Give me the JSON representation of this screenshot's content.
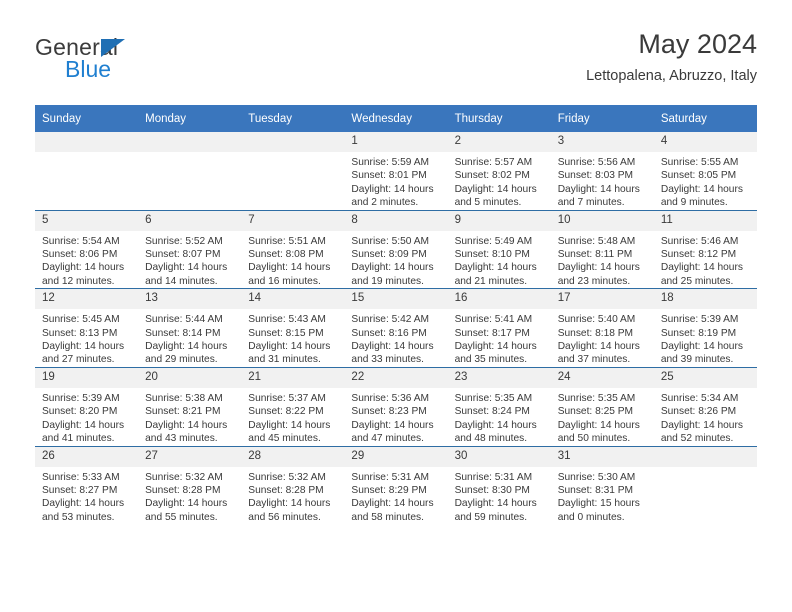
{
  "brand": {
    "name_top": "General",
    "name_bottom": "Blue",
    "triangle_color": "#1f6fb4",
    "blue_color": "#1f7fd0"
  },
  "header": {
    "title": "May 2024",
    "subtitle": "Lettopalena, Abruzzo, Italy"
  },
  "theme": {
    "header_band": "#3a76bd",
    "row_separator": "#2e6da4",
    "daynum_band": "#f1f1f1",
    "text": "#3a3a3a"
  },
  "weekdays": [
    "Sunday",
    "Monday",
    "Tuesday",
    "Wednesday",
    "Thursday",
    "Friday",
    "Saturday"
  ],
  "weeks": [
    [
      {
        "day": "",
        "sunrise": "",
        "sunset": "",
        "daylight": "",
        "empty": true
      },
      {
        "day": "",
        "sunrise": "",
        "sunset": "",
        "daylight": "",
        "empty": true
      },
      {
        "day": "",
        "sunrise": "",
        "sunset": "",
        "daylight": "",
        "empty": true
      },
      {
        "day": "1",
        "sunrise": "Sunrise: 5:59 AM",
        "sunset": "Sunset: 8:01 PM",
        "daylight": "Daylight: 14 hours and 2 minutes."
      },
      {
        "day": "2",
        "sunrise": "Sunrise: 5:57 AM",
        "sunset": "Sunset: 8:02 PM",
        "daylight": "Daylight: 14 hours and 5 minutes."
      },
      {
        "day": "3",
        "sunrise": "Sunrise: 5:56 AM",
        "sunset": "Sunset: 8:03 PM",
        "daylight": "Daylight: 14 hours and 7 minutes."
      },
      {
        "day": "4",
        "sunrise": "Sunrise: 5:55 AM",
        "sunset": "Sunset: 8:05 PM",
        "daylight": "Daylight: 14 hours and 9 minutes."
      }
    ],
    [
      {
        "day": "5",
        "sunrise": "Sunrise: 5:54 AM",
        "sunset": "Sunset: 8:06 PM",
        "daylight": "Daylight: 14 hours and 12 minutes."
      },
      {
        "day": "6",
        "sunrise": "Sunrise: 5:52 AM",
        "sunset": "Sunset: 8:07 PM",
        "daylight": "Daylight: 14 hours and 14 minutes."
      },
      {
        "day": "7",
        "sunrise": "Sunrise: 5:51 AM",
        "sunset": "Sunset: 8:08 PM",
        "daylight": "Daylight: 14 hours and 16 minutes."
      },
      {
        "day": "8",
        "sunrise": "Sunrise: 5:50 AM",
        "sunset": "Sunset: 8:09 PM",
        "daylight": "Daylight: 14 hours and 19 minutes."
      },
      {
        "day": "9",
        "sunrise": "Sunrise: 5:49 AM",
        "sunset": "Sunset: 8:10 PM",
        "daylight": "Daylight: 14 hours and 21 minutes."
      },
      {
        "day": "10",
        "sunrise": "Sunrise: 5:48 AM",
        "sunset": "Sunset: 8:11 PM",
        "daylight": "Daylight: 14 hours and 23 minutes."
      },
      {
        "day": "11",
        "sunrise": "Sunrise: 5:46 AM",
        "sunset": "Sunset: 8:12 PM",
        "daylight": "Daylight: 14 hours and 25 minutes."
      }
    ],
    [
      {
        "day": "12",
        "sunrise": "Sunrise: 5:45 AM",
        "sunset": "Sunset: 8:13 PM",
        "daylight": "Daylight: 14 hours and 27 minutes."
      },
      {
        "day": "13",
        "sunrise": "Sunrise: 5:44 AM",
        "sunset": "Sunset: 8:14 PM",
        "daylight": "Daylight: 14 hours and 29 minutes."
      },
      {
        "day": "14",
        "sunrise": "Sunrise: 5:43 AM",
        "sunset": "Sunset: 8:15 PM",
        "daylight": "Daylight: 14 hours and 31 minutes."
      },
      {
        "day": "15",
        "sunrise": "Sunrise: 5:42 AM",
        "sunset": "Sunset: 8:16 PM",
        "daylight": "Daylight: 14 hours and 33 minutes."
      },
      {
        "day": "16",
        "sunrise": "Sunrise: 5:41 AM",
        "sunset": "Sunset: 8:17 PM",
        "daylight": "Daylight: 14 hours and 35 minutes."
      },
      {
        "day": "17",
        "sunrise": "Sunrise: 5:40 AM",
        "sunset": "Sunset: 8:18 PM",
        "daylight": "Daylight: 14 hours and 37 minutes."
      },
      {
        "day": "18",
        "sunrise": "Sunrise: 5:39 AM",
        "sunset": "Sunset: 8:19 PM",
        "daylight": "Daylight: 14 hours and 39 minutes."
      }
    ],
    [
      {
        "day": "19",
        "sunrise": "Sunrise: 5:39 AM",
        "sunset": "Sunset: 8:20 PM",
        "daylight": "Daylight: 14 hours and 41 minutes."
      },
      {
        "day": "20",
        "sunrise": "Sunrise: 5:38 AM",
        "sunset": "Sunset: 8:21 PM",
        "daylight": "Daylight: 14 hours and 43 minutes."
      },
      {
        "day": "21",
        "sunrise": "Sunrise: 5:37 AM",
        "sunset": "Sunset: 8:22 PM",
        "daylight": "Daylight: 14 hours and 45 minutes."
      },
      {
        "day": "22",
        "sunrise": "Sunrise: 5:36 AM",
        "sunset": "Sunset: 8:23 PM",
        "daylight": "Daylight: 14 hours and 47 minutes."
      },
      {
        "day": "23",
        "sunrise": "Sunrise: 5:35 AM",
        "sunset": "Sunset: 8:24 PM",
        "daylight": "Daylight: 14 hours and 48 minutes."
      },
      {
        "day": "24",
        "sunrise": "Sunrise: 5:35 AM",
        "sunset": "Sunset: 8:25 PM",
        "daylight": "Daylight: 14 hours and 50 minutes."
      },
      {
        "day": "25",
        "sunrise": "Sunrise: 5:34 AM",
        "sunset": "Sunset: 8:26 PM",
        "daylight": "Daylight: 14 hours and 52 minutes."
      }
    ],
    [
      {
        "day": "26",
        "sunrise": "Sunrise: 5:33 AM",
        "sunset": "Sunset: 8:27 PM",
        "daylight": "Daylight: 14 hours and 53 minutes."
      },
      {
        "day": "27",
        "sunrise": "Sunrise: 5:32 AM",
        "sunset": "Sunset: 8:28 PM",
        "daylight": "Daylight: 14 hours and 55 minutes."
      },
      {
        "day": "28",
        "sunrise": "Sunrise: 5:32 AM",
        "sunset": "Sunset: 8:28 PM",
        "daylight": "Daylight: 14 hours and 56 minutes."
      },
      {
        "day": "29",
        "sunrise": "Sunrise: 5:31 AM",
        "sunset": "Sunset: 8:29 PM",
        "daylight": "Daylight: 14 hours and 58 minutes."
      },
      {
        "day": "30",
        "sunrise": "Sunrise: 5:31 AM",
        "sunset": "Sunset: 8:30 PM",
        "daylight": "Daylight: 14 hours and 59 minutes."
      },
      {
        "day": "31",
        "sunrise": "Sunrise: 5:30 AM",
        "sunset": "Sunset: 8:31 PM",
        "daylight": "Daylight: 15 hours and 0 minutes."
      },
      {
        "day": "",
        "sunrise": "",
        "sunset": "",
        "daylight": "",
        "empty": true
      }
    ]
  ]
}
